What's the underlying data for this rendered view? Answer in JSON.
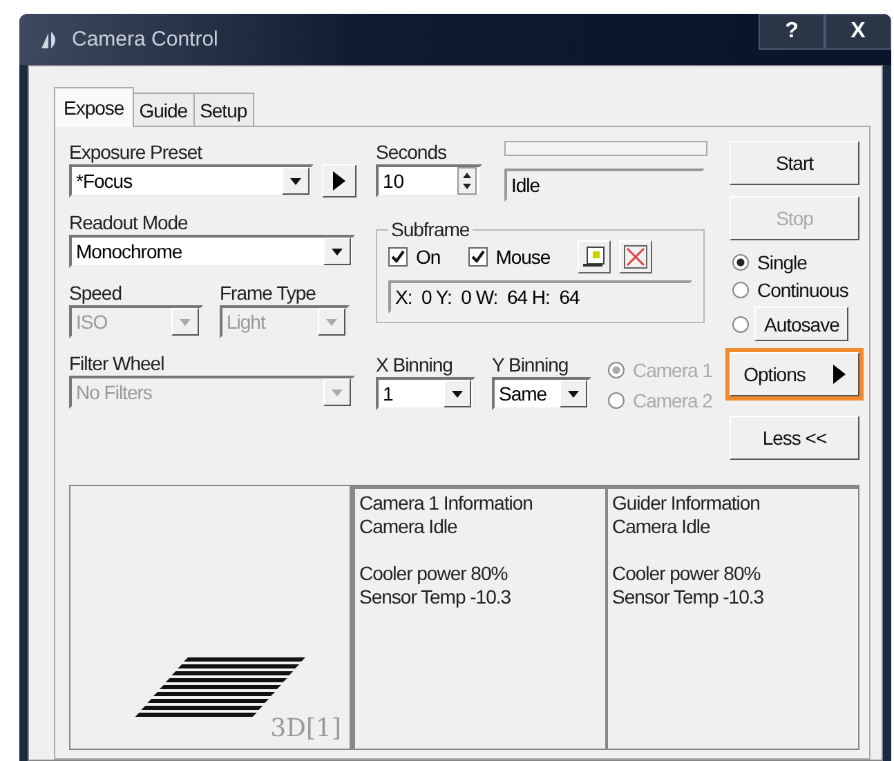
{
  "window": {
    "title": "Camera Control",
    "help": "?",
    "close": "X"
  },
  "tabs": [
    {
      "label": "Expose",
      "selected": true
    },
    {
      "label": "Guide",
      "selected": false
    },
    {
      "label": "Setup",
      "selected": false
    }
  ],
  "exposure_preset": {
    "label": "Exposure Preset",
    "value": "*Focus"
  },
  "readout_mode": {
    "label": "Readout Mode",
    "value": "Monochrome"
  },
  "speed": {
    "label": "Speed",
    "value": "ISO",
    "disabled": true
  },
  "frame_type": {
    "label": "Frame Type",
    "value": "Light",
    "disabled": true
  },
  "filter_wheel": {
    "label": "Filter Wheel",
    "value": "No Filters",
    "disabled": true
  },
  "seconds": {
    "label": "Seconds",
    "value": "10"
  },
  "progress": {
    "level": 0
  },
  "status": "Idle",
  "subframe": {
    "label": "Subframe",
    "on": {
      "label": "On",
      "checked": true
    },
    "mouse": {
      "label": "Mouse",
      "checked": true
    },
    "coords": "X:  0 Y:  0 W:  64 H:  64"
  },
  "x_binning": {
    "label": "X Binning",
    "value": "1"
  },
  "y_binning": {
    "label": "Y Binning",
    "value": "Same"
  },
  "cameras": [
    {
      "label": "Camera 1",
      "selected": true,
      "disabled": true
    },
    {
      "label": "Camera 2",
      "selected": false,
      "disabled": true
    }
  ],
  "buttons": {
    "start": {
      "label": "Start",
      "disabled": false
    },
    "stop": {
      "label": "Stop",
      "disabled": true
    },
    "options": {
      "label": "Options",
      "highlighted": true
    },
    "less": {
      "label": "Less <<"
    }
  },
  "modes": [
    {
      "label": "Single",
      "selected": true,
      "kind": "radio"
    },
    {
      "label": "Continuous",
      "selected": false,
      "kind": "radio"
    },
    {
      "label": "Autosave",
      "selected": false,
      "kind": "button"
    }
  ],
  "preview": {
    "caption": "3D[1]"
  },
  "info": [
    {
      "heading": [
        "Camera 1 Information",
        "Camera Idle"
      ],
      "details": [
        "Cooler power 80%",
        "Sensor Temp -10.3"
      ]
    },
    {
      "heading": [
        "Guider Information",
        "Camera Idle"
      ],
      "details": [
        "Cooler power 80%",
        "Sensor Temp -10.3"
      ]
    }
  ]
}
